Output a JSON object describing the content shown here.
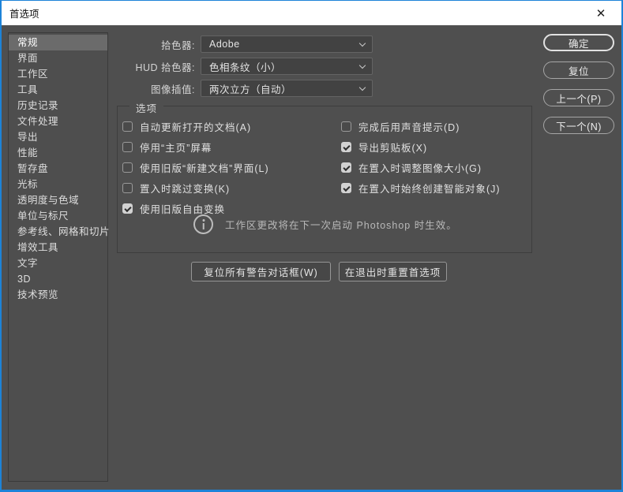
{
  "window": {
    "title": "首选项",
    "close_glyph": "✕",
    "accent_color": "#1d83d8",
    "bg_color": "#4f4f4f"
  },
  "sidebar": {
    "items": [
      {
        "label": "常规",
        "selected": true
      },
      {
        "label": "界面",
        "selected": false
      },
      {
        "label": "工作区",
        "selected": false
      },
      {
        "label": "工具",
        "selected": false
      },
      {
        "label": "历史记录",
        "selected": false
      },
      {
        "label": "文件处理",
        "selected": false
      },
      {
        "label": "导出",
        "selected": false
      },
      {
        "label": "性能",
        "selected": false
      },
      {
        "label": "暂存盘",
        "selected": false
      },
      {
        "label": "光标",
        "selected": false
      },
      {
        "label": "透明度与色域",
        "selected": false
      },
      {
        "label": "单位与标尺",
        "selected": false
      },
      {
        "label": "参考线、网格和切片",
        "selected": false
      },
      {
        "label": "增效工具",
        "selected": false
      },
      {
        "label": "文字",
        "selected": false
      },
      {
        "label": "3D",
        "selected": false
      },
      {
        "label": "技术预览",
        "selected": false
      }
    ]
  },
  "pickers": [
    {
      "label": "拾色器:",
      "value": "Adobe"
    },
    {
      "label": "HUD 拾色器:",
      "value": "色相条纹（小）"
    },
    {
      "label": "图像插值:",
      "value": "两次立方（自动）"
    }
  ],
  "options": {
    "title": "选项",
    "left": [
      {
        "label": "自动更新打开的文档(A)",
        "checked": false
      },
      {
        "label": "停用“主页”屏幕",
        "checked": false
      },
      {
        "label": "使用旧版“新建文档”界面(L)",
        "checked": false
      },
      {
        "label": "置入时跳过变换(K)",
        "checked": false
      },
      {
        "label": "使用旧版自由变换",
        "checked": true
      }
    ],
    "right": [
      {
        "label": "完成后用声音提示(D)",
        "checked": false
      },
      {
        "label": "导出剪贴板(X)",
        "checked": true
      },
      {
        "label": "在置入时调整图像大小(G)",
        "checked": true
      },
      {
        "label": "在置入时始终创建智能对象(J)",
        "checked": true
      }
    ],
    "note": "工作区更改将在下一次启动 Photoshop 时生效。"
  },
  "footer_buttons": [
    {
      "label": "复位所有警告对话框(W)"
    },
    {
      "label": "在退出时重置首选项"
    }
  ],
  "side_buttons": [
    {
      "label": "确定",
      "default": true
    },
    {
      "label": "复位",
      "default": false
    },
    {
      "label": "上一个(P)",
      "default": false
    },
    {
      "label": "下一个(N)",
      "default": false
    }
  ]
}
